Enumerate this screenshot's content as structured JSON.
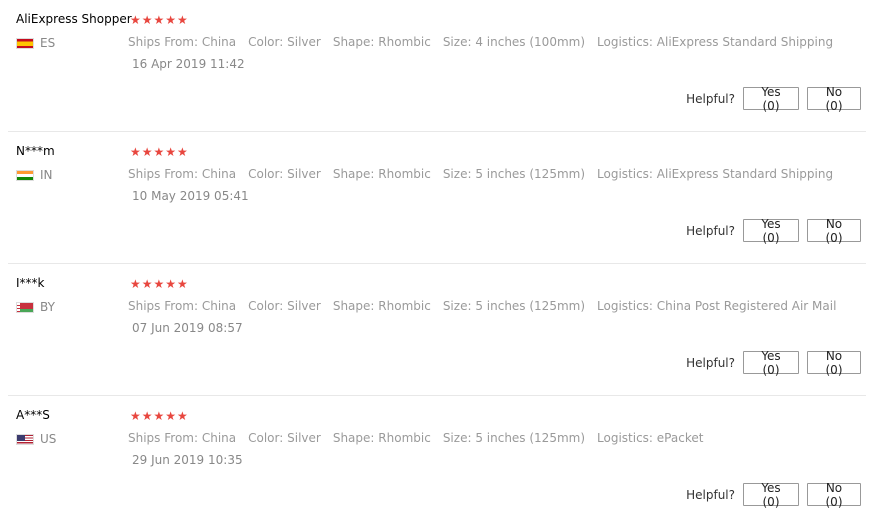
{
  "reviews": [
    {
      "user": "AliExpress Shopper",
      "country_code": "ES",
      "flag_icon": "spain-flag-icon",
      "stars": "★★★★★",
      "ships_from_label": "Ships From:",
      "ships_from": "China",
      "color_label": "Color:",
      "color": "Silver",
      "shape_label": "Shape:",
      "shape": "Rhombic",
      "size_label": "Size:",
      "size": "4 inches (100mm)",
      "logistics_label": "Logistics:",
      "logistics": "AliExpress Standard Shipping",
      "date": "16 Apr 2019 11:42",
      "helpful_label": "Helpful?",
      "yes_label": "Yes (0)",
      "no_label": "No (0)"
    },
    {
      "user": "N***m",
      "country_code": "IN",
      "flag_icon": "india-flag-icon",
      "stars": "★★★★★",
      "ships_from_label": "Ships From:",
      "ships_from": "China",
      "color_label": "Color:",
      "color": "Silver",
      "shape_label": "Shape:",
      "shape": "Rhombic",
      "size_label": "Size:",
      "size": "5 inches (125mm)",
      "logistics_label": "Logistics:",
      "logistics": "AliExpress Standard Shipping",
      "date": "10 May 2019 05:41",
      "helpful_label": "Helpful?",
      "yes_label": "Yes (0)",
      "no_label": "No (0)"
    },
    {
      "user": "I***k",
      "country_code": "BY",
      "flag_icon": "belarus-flag-icon",
      "stars": "★★★★★",
      "ships_from_label": "Ships From:",
      "ships_from": "China",
      "color_label": "Color:",
      "color": "Silver",
      "shape_label": "Shape:",
      "shape": "Rhombic",
      "size_label": "Size:",
      "size": "5 inches (125mm)",
      "logistics_label": "Logistics:",
      "logistics": "China Post Registered Air Mail",
      "date": "07 Jun 2019 08:57",
      "helpful_label": "Helpful?",
      "yes_label": "Yes (0)",
      "no_label": "No (0)"
    },
    {
      "user": "A***S",
      "country_code": "US",
      "flag_icon": "usa-flag-icon",
      "stars": "★★★★★",
      "ships_from_label": "Ships From:",
      "ships_from": "China",
      "color_label": "Color:",
      "color": "Silver",
      "shape_label": "Shape:",
      "shape": "Rhombic",
      "size_label": "Size:",
      "size": "5 inches (125mm)",
      "logistics_label": "Logistics:",
      "logistics": "ePacket",
      "date": "29 Jun 2019 10:35",
      "helpful_label": "Helpful?",
      "yes_label": "Yes (0)",
      "no_label": "No (0)"
    }
  ],
  "colors": {
    "star": "#e8473f",
    "muted_text": "#9a9a9a",
    "divider": "#e8e8e8"
  }
}
